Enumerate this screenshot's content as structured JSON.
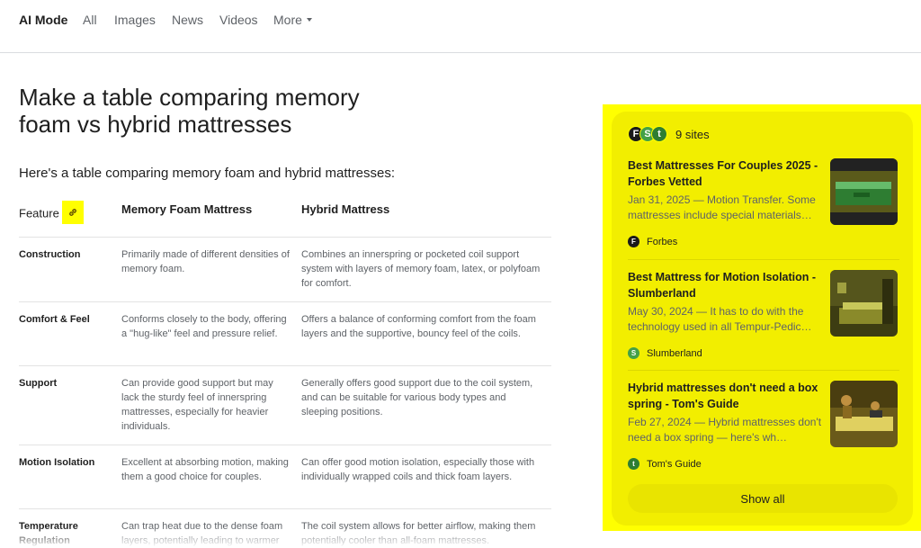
{
  "nav": {
    "tabs": [
      {
        "label": "AI Mode"
      },
      {
        "label": "All"
      },
      {
        "label": "Images"
      },
      {
        "label": "News"
      },
      {
        "label": "Videos"
      },
      {
        "label": "More"
      }
    ]
  },
  "main": {
    "title": "Make a table comparing memory foam vs hybrid mattresses",
    "intro": "Here's a table comparing memory foam and hybrid mattresses:",
    "table": {
      "headers": [
        "Feature",
        "Memory Foam Mattress",
        "Hybrid Mattress"
      ],
      "rows": [
        {
          "feature": "Construction",
          "memory": "Primarily made of different densities of memory foam.",
          "hybrid": "Combines an innerspring or pocketed coil support system with layers of memory foam, latex, or polyfoam for comfort."
        },
        {
          "feature": "Comfort & Feel",
          "memory": "Conforms closely to the body, offering a \"hug-like\" feel and pressure relief.",
          "hybrid": "Offers a balance of conforming comfort from the foam layers and the supportive, bouncy feel of the coils."
        },
        {
          "feature": "Support",
          "memory": "Can provide good support but may lack the sturdy feel of innerspring mattresses, especially for heavier individuals.",
          "hybrid": "Generally offers good support due to the coil system, and can be suitable for various body types and sleeping positions."
        },
        {
          "feature": "Motion Isolation",
          "memory": "Excellent at absorbing motion, making them a good choice for couples.",
          "hybrid": "Can offer good motion isolation, especially those with individually wrapped coils and thick foam layers."
        },
        {
          "feature": "Temperature Regulation",
          "memory": "Can trap heat due to the dense foam layers, potentially leading to warmer sleep for some.",
          "hybrid": "The coil system allows for better airflow, making them potentially cooler than all-foam mattresses."
        }
      ]
    }
  },
  "sources": {
    "count_label": "9 sites",
    "favicons": [
      {
        "letter": "F",
        "color": "#1a1a1a",
        "icon": "forbes-favicon"
      },
      {
        "letter": "S",
        "color": "#43a047",
        "icon": "slumberland-favicon"
      },
      {
        "letter": "t",
        "color": "#2e7d32",
        "icon": "toms-guide-favicon"
      }
    ],
    "cards": [
      {
        "title": "Best Mattresses For Couples 2025 - Forbes Vetted",
        "desc": "Jan 31, 2025 — Motion Transfer. Some mattresses include special materials…",
        "source": "Forbes",
        "icon_letter": "F",
        "icon_color": "#1a1a1a"
      },
      {
        "title": "Best Mattress for Motion Isolation - Slumberland",
        "desc": "May 30, 2024 — It has to do with the technology used in all Tempur-Pedic…",
        "source": "Slumberland",
        "icon_letter": "S",
        "icon_color": "#43a047"
      },
      {
        "title": "Hybrid mattresses don't need a box spring - Tom's Guide",
        "desc": "Feb 27, 2024 — Hybrid mattresses don't need a box spring — here's wh…",
        "source": "Tom's Guide",
        "icon_letter": "t",
        "icon_color": "#2e7d32"
      }
    ],
    "show_all": "Show all"
  },
  "colors": {
    "highlight": "#ffff00",
    "text_primary": "#1f1f1f",
    "text_secondary": "#5f6368"
  }
}
